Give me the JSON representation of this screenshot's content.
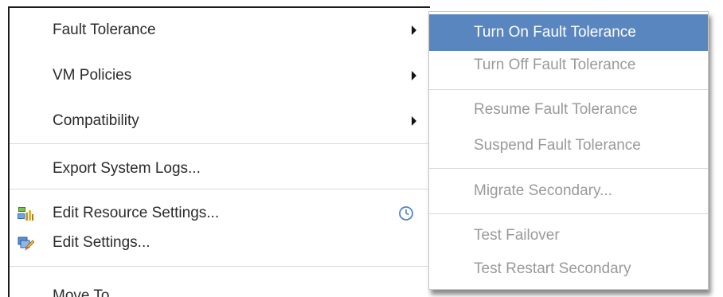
{
  "main_menu": {
    "items": [
      {
        "label": "Fault Tolerance",
        "has_submenu": true
      },
      {
        "label": "VM Policies",
        "has_submenu": true
      },
      {
        "label": "Compatibility",
        "has_submenu": true
      },
      {
        "label": "Export System Logs..."
      },
      {
        "label": "Edit Resource Settings...",
        "icon": "resource-settings-icon",
        "trailing_icon": "clock-icon"
      },
      {
        "label": "Edit Settings...",
        "icon": "edit-settings-icon"
      },
      {
        "label": "Move To..."
      }
    ]
  },
  "submenu": {
    "items": [
      {
        "label": "Turn On Fault Tolerance",
        "state": "highlighted"
      },
      {
        "label": "Turn Off Fault Tolerance",
        "state": "disabled"
      },
      {
        "label": "Resume Fault Tolerance",
        "state": "disabled"
      },
      {
        "label": "Suspend Fault Tolerance",
        "state": "disabled"
      },
      {
        "label": "Migrate Secondary...",
        "state": "disabled"
      },
      {
        "label": "Test Failover",
        "state": "disabled"
      },
      {
        "label": "Test Restart Secondary",
        "state": "disabled"
      }
    ]
  },
  "colors": {
    "highlight": "#5a86c0",
    "disabled_text": "#9a9a9a",
    "text": "#2b2b2b"
  }
}
